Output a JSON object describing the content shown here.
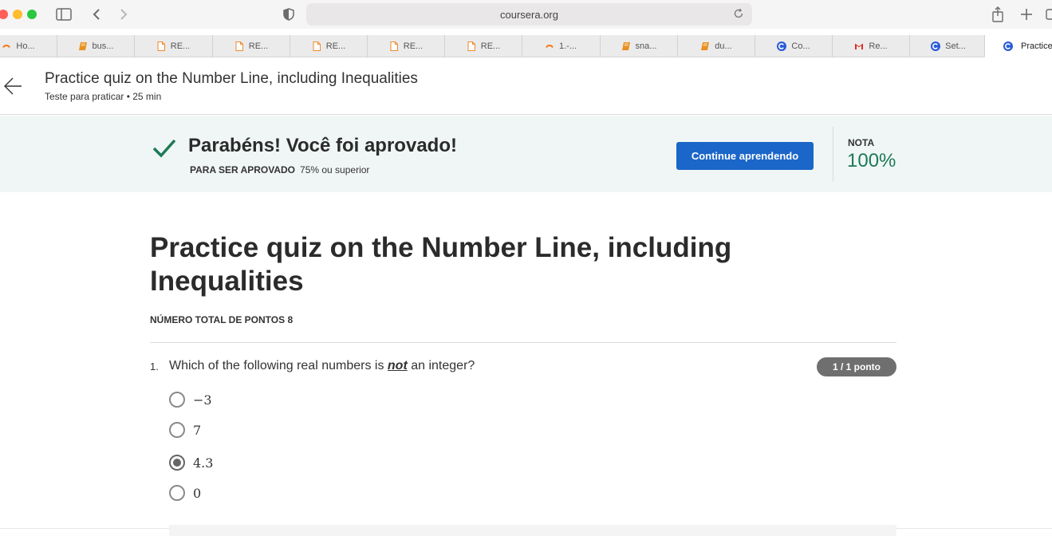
{
  "browser": {
    "url": "coursera.org",
    "tabs": [
      {
        "label": "Ho...",
        "icon": "loading-ring-icon",
        "color": "#f47a20"
      },
      {
        "label": "bus...",
        "icon": "book-icon",
        "color": "#e8901f"
      },
      {
        "label": "RE...",
        "icon": "document-icon",
        "color": "#f0892d"
      },
      {
        "label": "RE...",
        "icon": "document-icon",
        "color": "#f0892d"
      },
      {
        "label": "RE...",
        "icon": "document-icon",
        "color": "#f0892d"
      },
      {
        "label": "RE...",
        "icon": "document-icon",
        "color": "#f0892d"
      },
      {
        "label": "RE...",
        "icon": "document-icon",
        "color": "#f0892d"
      },
      {
        "label": "1.-...",
        "icon": "loading-ring-icon",
        "color": "#f47a20"
      },
      {
        "label": "sna...",
        "icon": "book-icon",
        "color": "#e8901f"
      },
      {
        "label": "du...",
        "icon": "book-icon",
        "color": "#e8901f"
      },
      {
        "label": "Co...",
        "icon": "coursera-icon",
        "color": "#2a5bd7"
      },
      {
        "label": "Re...",
        "icon": "gmail-icon",
        "color": "#d93025"
      },
      {
        "label": "Set...",
        "icon": "coursera-icon",
        "color": "#2a5bd7"
      },
      {
        "label": "Practice",
        "icon": "coursera-icon",
        "color": "#2a5bd7"
      }
    ]
  },
  "header": {
    "title": "Practice quiz on the Number Line, including Inequalities",
    "subtitle": "Teste para praticar • 25 min"
  },
  "banner": {
    "message": "Parabéns! Você foi aprovado!",
    "pass_label": "PARA SER APROVADO",
    "pass_value": "75% ou superior",
    "continue_label": "Continue aprendendo",
    "grade_label": "NOTA",
    "grade_value": "100%"
  },
  "quiz": {
    "title": "Practice quiz on the Number Line, including Inequalities",
    "total_points": "NÚMERO TOTAL DE PONTOS 8",
    "questions": [
      {
        "number": "1.",
        "text_before": "Which of the following real numbers is ",
        "text_emphasis": "not",
        "text_after": " an integer?",
        "score": "1 / 1 ponto",
        "options": [
          {
            "label": "−3",
            "selected": false
          },
          {
            "label": "7",
            "selected": false
          },
          {
            "label": "4.3",
            "selected": true
          },
          {
            "label": "0",
            "selected": false
          }
        ]
      }
    ]
  },
  "colors": {
    "accent": "#1b66c9",
    "success": "#1d7a55",
    "banner_bg": "#f0f6f5"
  }
}
